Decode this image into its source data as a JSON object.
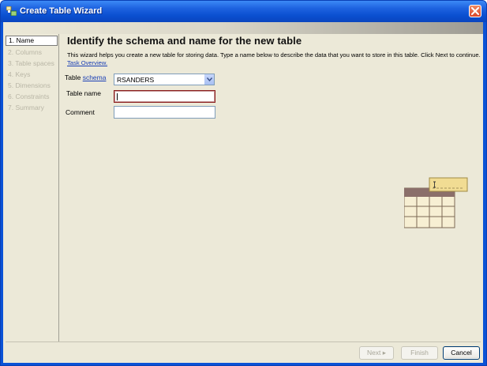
{
  "window": {
    "title": "Create Table Wizard"
  },
  "steps": [
    "1. Name",
    "2. Columns",
    "3. Table spaces",
    "4. Keys",
    "5. Dimensions",
    "6. Constraints",
    "7. Summary"
  ],
  "main": {
    "heading": "Identify the schema and name for the new table",
    "description": "This wizard helps you create a new table for storing data. Type a name below to describe the data that you want to store in this table. Click Next to continue.",
    "task_link": "Task Overview."
  },
  "form": {
    "schema_label_prefix": "Table",
    "schema_label_link": "schema",
    "schema_value": "RSANDERS",
    "name_label": "Table name",
    "name_value": "",
    "comment_label": "Comment",
    "comment_value": ""
  },
  "buttons": {
    "next": "Next ▸",
    "finish": "Finish",
    "cancel": "Cancel"
  },
  "colors": {
    "titlebar": "#0a52d6",
    "panel": "#ece9d8",
    "link": "#1a3fb5",
    "focus_border": "#8b1d1d"
  }
}
